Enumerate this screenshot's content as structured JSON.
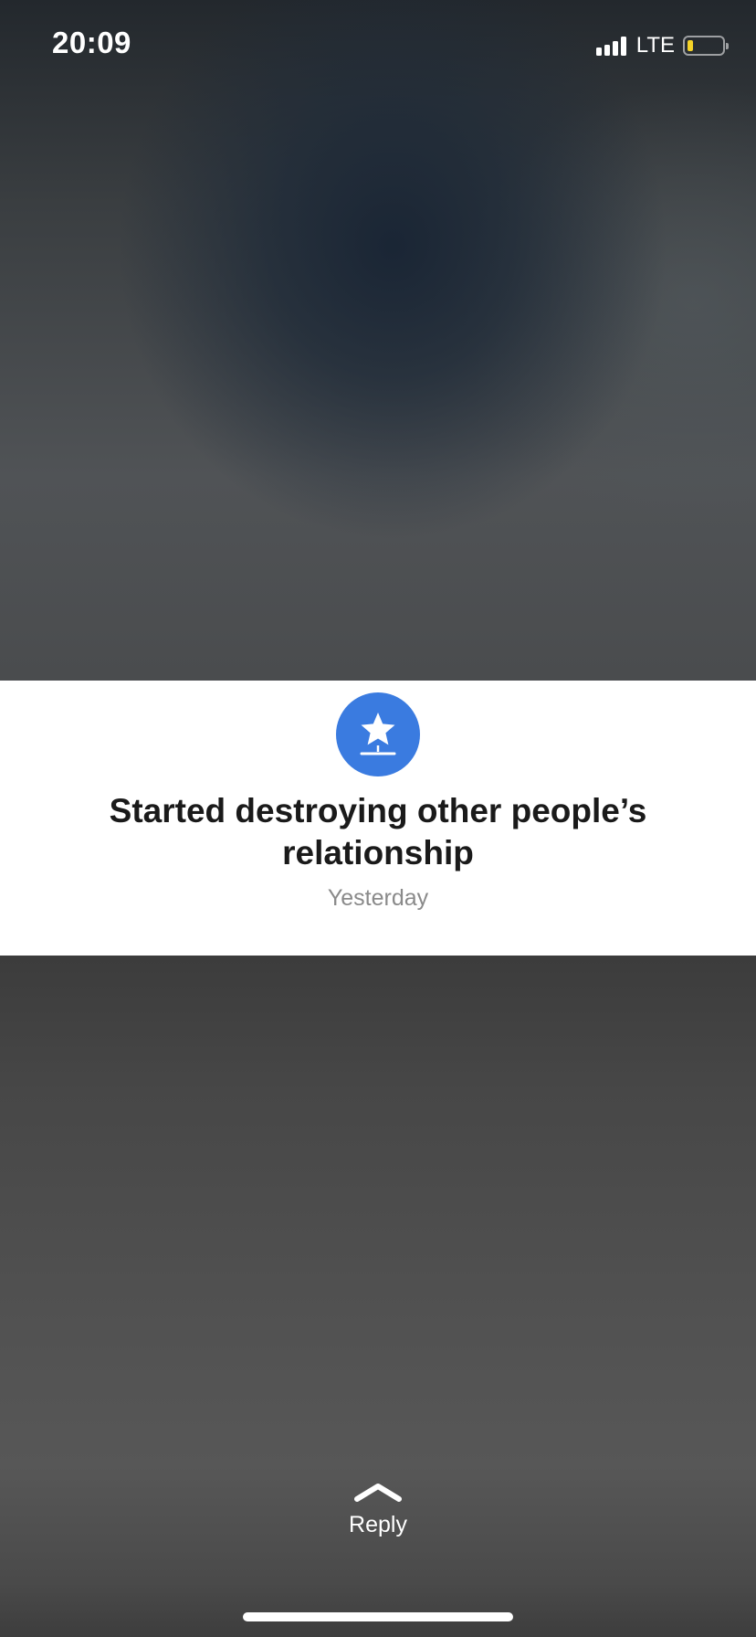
{
  "status_bar": {
    "time": "20:09",
    "network": "LTE",
    "signal_bars": 4,
    "battery_level": 0.1,
    "battery_color": "#f5d328"
  },
  "notification": {
    "icon": "star-icon",
    "icon_color": "#3a7be0",
    "title": "Started destroying other people’s relationship",
    "timestamp": "Yesterday"
  },
  "reply": {
    "icon": "chevron-up-icon",
    "label": "Reply"
  }
}
